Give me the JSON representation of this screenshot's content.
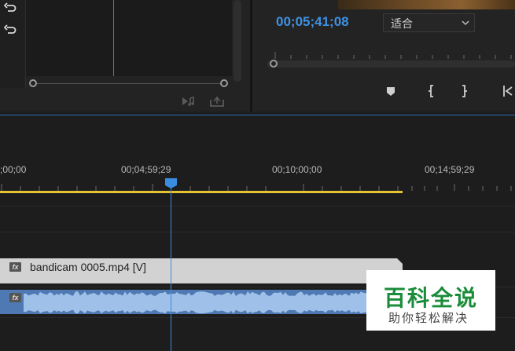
{
  "effect_controls": {
    "reset_icons": [
      "reset-icon",
      "reset-icon"
    ],
    "bottom_icons": [
      "play-audio-icon",
      "export-frame-icon"
    ]
  },
  "program_monitor": {
    "timecode": "00;05;41;08",
    "fit_dropdown": {
      "selected": "适合",
      "icon": "chevron-down-icon"
    },
    "controls": [
      "add-marker-icon",
      "mark-in-icon",
      "mark-out-icon",
      "go-to-in-icon"
    ]
  },
  "timeline": {
    "ruler_labels": [
      ";00;00",
      "00;04;59;29",
      "00;10;00;00",
      "00;14;59;29"
    ],
    "video_clip": {
      "fx_label": "fx",
      "name": "bandicam 0005.mp4 [V]"
    },
    "audio_clip": {
      "fx_label": "fx"
    },
    "playhead_time": "00;05;41;08"
  },
  "watermark": {
    "title": "百科全说",
    "subtitle": "助你轻松解决"
  },
  "colors": {
    "timecode": "#3e91e3",
    "work_area": "#e5c332",
    "playhead": "#3a8ce0",
    "video_clip": "#d2d2d2",
    "audio_clip": "#4f79b3",
    "watermark_green": "#1b8c3a"
  }
}
